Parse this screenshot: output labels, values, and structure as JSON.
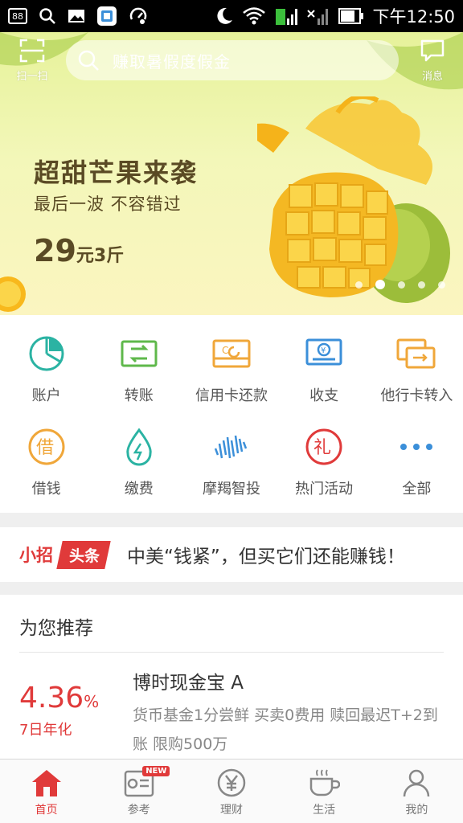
{
  "status_bar": {
    "notif_count": "88",
    "time": "下午12:50"
  },
  "header": {
    "scan_label": "扫一扫",
    "search_placeholder": "赚取暑假度假金",
    "message_label": "消息"
  },
  "banner": {
    "title": "超甜芒果来袭",
    "subtitle": "最后一波 不容错过",
    "price_number": "29",
    "price_unit": "元3斤",
    "dot_count": 5,
    "active_dot": 2
  },
  "grid": {
    "row1": [
      {
        "label": "账户",
        "icon": "pie-chart-icon",
        "color": "#2bb3a3"
      },
      {
        "label": "转账",
        "icon": "transfer-icon",
        "color": "#5fb84b"
      },
      {
        "label": "信用卡还款",
        "icon": "credit-card-icon",
        "color": "#f0a73a"
      },
      {
        "label": "收支",
        "icon": "income-expense-icon",
        "color": "#3b8fd9"
      },
      {
        "label": "他行卡转入",
        "icon": "other-bank-card-icon",
        "color": "#f0a73a"
      }
    ],
    "row2": [
      {
        "label": "借钱",
        "icon": "borrow-icon",
        "icon_text": "借",
        "color": "#f0a73a"
      },
      {
        "label": "缴费",
        "icon": "water-drop-icon",
        "color": "#2bb3a3"
      },
      {
        "label": "摩羯智投",
        "icon": "wave-bars-icon",
        "color": "#3b8fd9"
      },
      {
        "label": "热门活动",
        "icon": "gift-icon",
        "icon_text": "礼",
        "color": "#e03a3a"
      },
      {
        "label": "全部",
        "icon": "more-dots-icon",
        "color": "#3b8fd9"
      }
    ]
  },
  "headline": {
    "prefix": "小招",
    "tag": "头条",
    "text": "中美“钱紧”，但买它们还能赚钱！"
  },
  "recommend": {
    "section_title": "为您推荐",
    "rate_number": "4.36",
    "rate_unit": "%",
    "rate_label": "7日年化",
    "product_name": "博时现金宝 A",
    "product_desc": "货币基金1分尝鲜 买卖0费用 赎回最迟T+2到账 限购500万"
  },
  "bottom_nav": {
    "items": [
      {
        "label": "首页",
        "icon": "home-icon"
      },
      {
        "label": "参考",
        "icon": "news-icon",
        "badge": "NEW"
      },
      {
        "label": "理财",
        "icon": "yuan-coin-icon"
      },
      {
        "label": "生活",
        "icon": "coffee-cup-icon"
      },
      {
        "label": "我的",
        "icon": "user-icon"
      }
    ],
    "active_index": 0
  },
  "colors": {
    "brand_red": "#e03a3a",
    "teal": "#2bb3a3",
    "green": "#5fb84b",
    "orange": "#f0a73a",
    "blue": "#3b8fd9"
  }
}
